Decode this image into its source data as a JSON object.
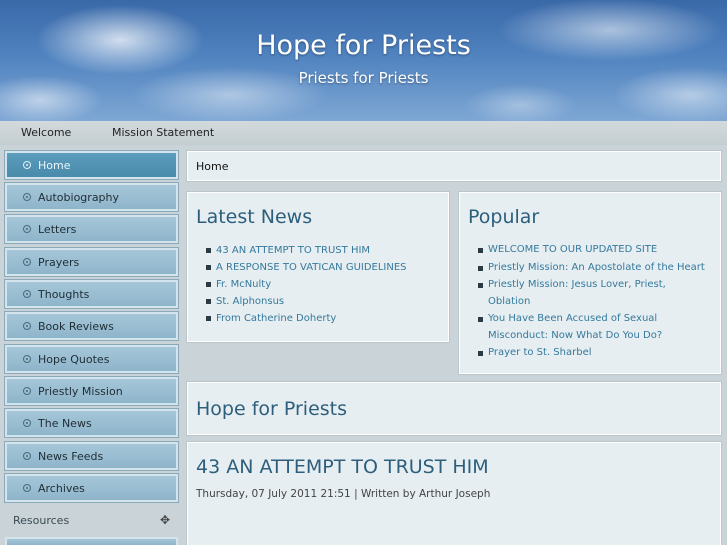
{
  "site": {
    "title": "Hope for Priests",
    "subtitle": "Priests for Priests"
  },
  "topnav": {
    "items": [
      "Welcome",
      "Mission Statement"
    ]
  },
  "sidebar": {
    "items": [
      {
        "label": "Home",
        "active": true
      },
      {
        "label": "Autobiography"
      },
      {
        "label": "Letters"
      },
      {
        "label": "Prayers"
      },
      {
        "label": "Thoughts"
      },
      {
        "label": "Book Reviews"
      },
      {
        "label": "Hope Quotes"
      },
      {
        "label": "Priestly Mission"
      },
      {
        "label": "The News"
      },
      {
        "label": "News Feeds"
      },
      {
        "label": "Archives"
      }
    ],
    "resources_label": "Resources",
    "resources_toggle_icon": "plus-arrow-icon"
  },
  "breadcrumb": {
    "text": "Home"
  },
  "latest_news": {
    "title": "Latest News",
    "items": [
      "43 AN ATTEMPT TO TRUST HIM",
      "A RESPONSE TO VATICAN GUIDELINES",
      "Fr. McNulty",
      "St. Alphonsus",
      "From Catherine Doherty"
    ]
  },
  "popular": {
    "title": "Popular",
    "items": [
      "WELCOME TO OUR UPDATED SITE",
      "Priestly Mission: An Apostolate of the Heart",
      "Priestly Mission: Jesus Lover, Priest, Oblation",
      "You Have Been Accused of Sexual Misconduct: Now What Do You Do?",
      "Prayer to St. Sharbel"
    ]
  },
  "main": {
    "section_title": "Hope for Priests",
    "article_title": "43 AN ATTEMPT TO TRUST HIM",
    "article_meta": "Thursday, 07 July 2011 21:51 | Written by Arthur Joseph"
  },
  "colors": {
    "heading": "#2d5f7d",
    "link": "#35799c",
    "active_nav": "#4a8aab"
  }
}
